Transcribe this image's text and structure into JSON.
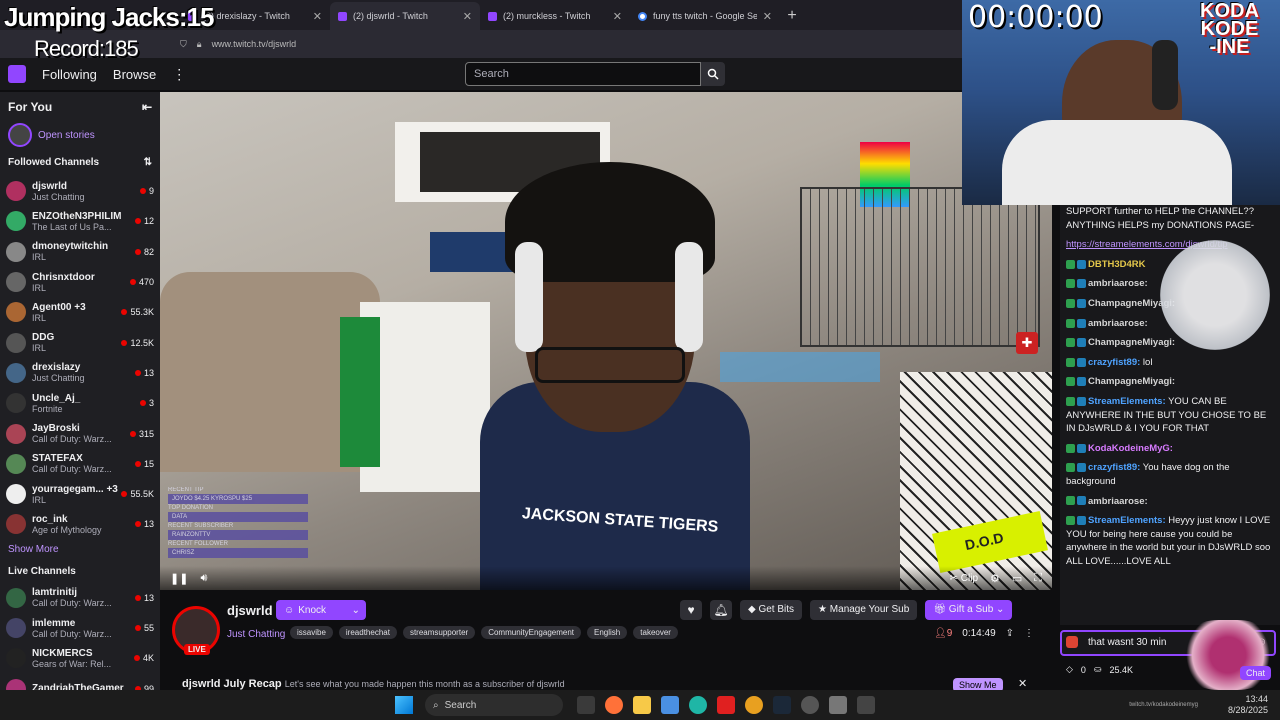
{
  "overlay": {
    "title": "Jumping Jacks:15",
    "record": "Record:185",
    "timer": "00:00:00",
    "logo_lines": [
      "KODA",
      "KODE",
      "-INE"
    ]
  },
  "browser": {
    "tabs": [
      {
        "label": "(2) drexislazy - Twitch",
        "icon": "twitch-icon",
        "active": false
      },
      {
        "label": "(2) djswrld - Twitch",
        "icon": "twitch-icon",
        "active": true
      },
      {
        "label": "(2) murckless - Twitch",
        "icon": "twitch-icon",
        "active": false
      },
      {
        "label": "funy tts twitch - Google Search",
        "icon": "google-icon",
        "active": false
      }
    ],
    "url": "www.twitch.tv/djswrld"
  },
  "nav": {
    "following": "Following",
    "browse": "Browse",
    "search_placeholder": "Search"
  },
  "sidebar": {
    "for_you": "For You",
    "open_stories": "Open stories",
    "followed_header": "Followed Channels",
    "followed": [
      {
        "name": "djswrld",
        "game": "Just Chatting",
        "viewers": "9",
        "color": "#b03060"
      },
      {
        "name": "ENZOtheN3PHILIM",
        "game": "The Last of Us Pa...",
        "viewers": "12",
        "color": "#3a6"
      },
      {
        "name": "dmoneytwitchin",
        "game": "IRL",
        "viewers": "82",
        "color": "#888"
      },
      {
        "name": "Chrisnxtdoor",
        "game": "IRL",
        "viewers": "470",
        "color": "#666"
      },
      {
        "name": "Agent00 +3",
        "game": "IRL",
        "viewers": "55.3K",
        "color": "#a63"
      },
      {
        "name": "DDG",
        "game": "IRL",
        "viewers": "12.5K",
        "color": "#555"
      },
      {
        "name": "drexislazy",
        "game": "Just Chatting",
        "viewers": "13",
        "color": "#468"
      },
      {
        "name": "Uncle_Aj_",
        "game": "Fortnite",
        "viewers": "3",
        "color": "#333"
      },
      {
        "name": "JayBroski",
        "game": "Call of Duty: Warz...",
        "viewers": "315",
        "color": "#a45"
      },
      {
        "name": "STATEFAX",
        "game": "Call of Duty: Warz...",
        "viewers": "15",
        "color": "#585"
      },
      {
        "name": "yourragegam... +3",
        "game": "IRL",
        "viewers": "55.5K",
        "color": "#eee"
      },
      {
        "name": "roc_ink",
        "game": "Age of Mythology",
        "viewers": "13",
        "color": "#833"
      }
    ],
    "show_more": "Show More",
    "live_header": "Live Channels",
    "live": [
      {
        "name": "lamtrinitij",
        "game": "Call of Duty: Warz...",
        "viewers": "13",
        "color": "#364"
      },
      {
        "name": "imlemme",
        "game": "Call of Duty: Warz...",
        "viewers": "55",
        "color": "#446"
      },
      {
        "name": "NICKMERCS",
        "game": "Gears of War: Rel...",
        "viewers": "4K",
        "color": "#222"
      },
      {
        "name": "ZandriahTheGamer",
        "game": "",
        "viewers": "99",
        "color": "#a37"
      }
    ]
  },
  "video_overlay": {
    "recent_tip": "RECENT TIP",
    "tip_line": "JOYDO $4.25  KYROSPU $25",
    "top_donation": "TOP DONATION",
    "data": "DATA",
    "recent_subscriber": "RECENT SUBSCRIBER",
    "subscriber_name": "RAINZONTTV",
    "recent_follower": "RECENT FOLLOWER",
    "follower_name": "CHRISZ",
    "clip": "Clip"
  },
  "channel": {
    "name": "djswrld",
    "live": "LIVE",
    "category": "Just Chatting",
    "tags": [
      "issavibe",
      "ireadthechat",
      "streamsupporter",
      "CommunityEngagement",
      "English",
      "takeover"
    ],
    "knock": "Knock",
    "get_bits": "Get Bits",
    "manage_sub": "Manage Your Sub",
    "gift_sub": "Gift a Sub",
    "viewers": "9",
    "uptime": "0:14:49",
    "recap_title": "djswrld July Recap",
    "recap_text": "Let's see what you made happen this month as a subscriber of djswrld",
    "show_me": "Show Me"
  },
  "chat": {
    "messages": [
      {
        "user": "",
        "text": "SUPPORT further to HELP the CHANNEL?? ANYTHING HELPS my DONATIONS PAGE-",
        "color": "#efeff1"
      },
      {
        "user": "",
        "text": "https://streamelements.com/djswrld/tip",
        "color": "#bf94ff",
        "link": true
      },
      {
        "user": "DBTH3D4RK",
        "text": "",
        "color": "#e3c74b"
      },
      {
        "user": "ambriaarose:",
        "text": "",
        "color": "#d6d6d6"
      },
      {
        "user": "ChampagneMiyagi:",
        "text": "",
        "color": "#d6d6d6"
      },
      {
        "user": "ambriaarose:",
        "text": "",
        "color": "#d6d6d6"
      },
      {
        "user": "ChampagneMiyagi:",
        "text": "",
        "color": "#d6d6d6"
      },
      {
        "user": "crazyfist89:",
        "text": "lol",
        "color": "#4fa3ff"
      },
      {
        "user": "ChampagneMiyagi:",
        "text": "",
        "color": "#d6d6d6"
      },
      {
        "user": "StreamElements:",
        "text": "YOU CAN BE ANYWHERE IN THE BUT YOU CHOSE TO BE IN DJsWRLD & I YOU FOR THAT",
        "color": "#4fa3ff"
      },
      {
        "user": "KodaKodeineMyG:",
        "text": "",
        "color": "#d77bff"
      },
      {
        "user": "crazyfist89:",
        "text": "You have dog on the background",
        "color": "#4fa3ff"
      },
      {
        "user": "ambriaarose:",
        "text": "",
        "color": "#d6d6d6"
      },
      {
        "user": "StreamElements:",
        "text": "Heyyy just know I LOVE YOU for being here cause you could be anywhere in the world but your in DJsWRLD soo ALL LOVE......LOVE ALL",
        "color": "#4fa3ff"
      }
    ],
    "input_value": "that wasnt 30 min",
    "points": "0",
    "bits": "25.4K",
    "chat_btn": "Chat"
  },
  "taskbar": {
    "search": "Search",
    "time": "13:44",
    "date": "8/28/2025",
    "url_note": "twitch.tv/kodakodeinemyg"
  },
  "colors": {
    "accent": "#9146ff",
    "live_red": "#eb0400",
    "bg": "#0e0e10"
  }
}
